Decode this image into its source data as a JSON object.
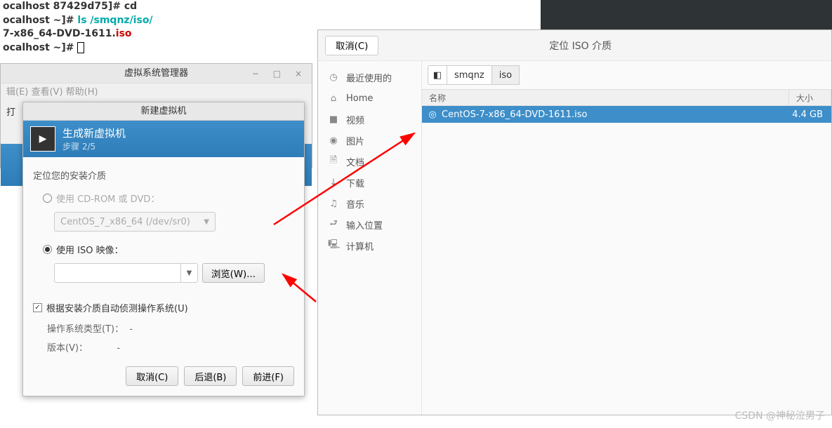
{
  "terminal": {
    "line1": "ocalhost 87429d75]# cd",
    "line2a": "ocalhost ~]# ",
    "line2b": "ls /smqnz/iso/",
    "line3a": "7-x86_64-DVD-1611.",
    "line3b": "iso",
    "line4": "ocalhost ~]# "
  },
  "vmm": {
    "title": "虚拟系统管理器",
    "controls": "−  □  ×",
    "menu": "辑(E)  查看(V)  帮助(H)",
    "toolbar_open": "打"
  },
  "wizard": {
    "window_title": "新建虚拟机",
    "header_title": "生成新虚拟机",
    "step": "步骤 2/5",
    "section_label": "定位您的安装介质",
    "radio_cdrom": "使用 CD-ROM 或 DVD：",
    "cdrom_combo": "CentOS_7_x86_64 (/dev/sr0)",
    "radio_iso": "使用 ISO 映像：",
    "browse_btn": "浏览(W)...",
    "auto_detect": "根据安装介质自动侦测操作系统(U)",
    "os_type_label": "操作系统类型(T)：",
    "os_type_value": "-",
    "version_label": "版本(V)：",
    "version_value": "-",
    "cancel": "取消(C)",
    "back": "后退(B)",
    "forward": "前进(F)"
  },
  "filechooser": {
    "cancel": "取消(C)",
    "title": "定位 ISO 介质",
    "path": {
      "seg1": "◧",
      "seg2": "smqnz",
      "seg3": "iso"
    },
    "columns": {
      "name": "名称",
      "size": "大小"
    },
    "sidebar": [
      {
        "icon": "◷",
        "label": "最近使用的"
      },
      {
        "icon": "⌂",
        "label": "Home"
      },
      {
        "icon": "■",
        "label": "视频"
      },
      {
        "icon": "◉",
        "label": "图片"
      },
      {
        "icon": "🗎",
        "label": "文档"
      },
      {
        "icon": "↓",
        "label": "下载"
      },
      {
        "icon": "♫",
        "label": "音乐"
      },
      {
        "icon": "⮐",
        "label": "输入位置"
      },
      {
        "icon": "🖳",
        "label": "计算机"
      }
    ],
    "file": {
      "icon": "◎",
      "name": "CentOS-7-x86_64-DVD-1611.iso",
      "size": "4.4 GB"
    }
  },
  "watermark": "CSDN @神秘泣男子"
}
